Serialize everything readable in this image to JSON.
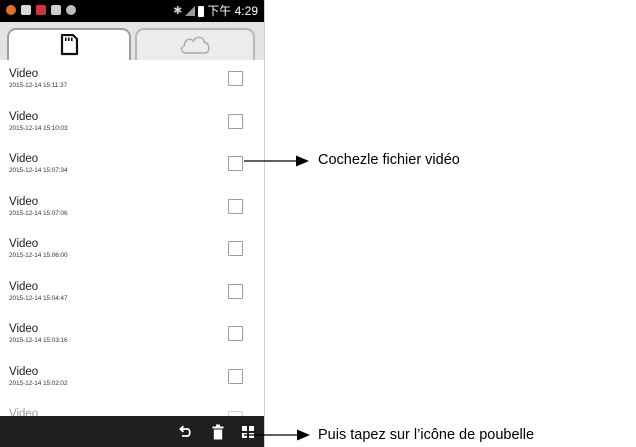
{
  "status_bar": {
    "time": "下午 4:29",
    "notification_icons": [
      "weather-icon",
      "gallery-icon",
      "app-icon",
      "message-icon",
      "settings-icon"
    ],
    "colors": {
      "background": "#000000",
      "text": "#ffffff"
    }
  },
  "tabs": [
    {
      "icon": "sd-card-icon",
      "selected": true
    },
    {
      "icon": "cloud-icon",
      "selected": false
    }
  ],
  "files": [
    {
      "title": "Video",
      "date": "2015-12-14 15:11:37",
      "checked": false
    },
    {
      "title": "Video",
      "date": "2015-12-14 15:10:03",
      "checked": false
    },
    {
      "title": "Video",
      "date": "2015-12-14 15:07:34",
      "checked": false
    },
    {
      "title": "Video",
      "date": "2015-12-14 15:07:06",
      "checked": false
    },
    {
      "title": "Video",
      "date": "2015-12-14 15:06:00",
      "checked": false
    },
    {
      "title": "Video",
      "date": "2015-12-14 15:04:47",
      "checked": false
    },
    {
      "title": "Video",
      "date": "2015-12-14 15:03:16",
      "checked": false
    },
    {
      "title": "Video",
      "date": "2015-12-14 15:02:02",
      "checked": false
    },
    {
      "title": "Video",
      "date": "",
      "checked": false
    }
  ],
  "bottom_bar": {
    "icons": [
      "back-icon",
      "trash-icon",
      "grid-icon"
    ],
    "colors": {
      "background": "#1f1f1f",
      "icon": "#ffffff"
    }
  },
  "annotations": {
    "check_file": "Cochezle fichier vidéo",
    "tap_trash": "Puis tapez sur l’icône de poubelle"
  }
}
